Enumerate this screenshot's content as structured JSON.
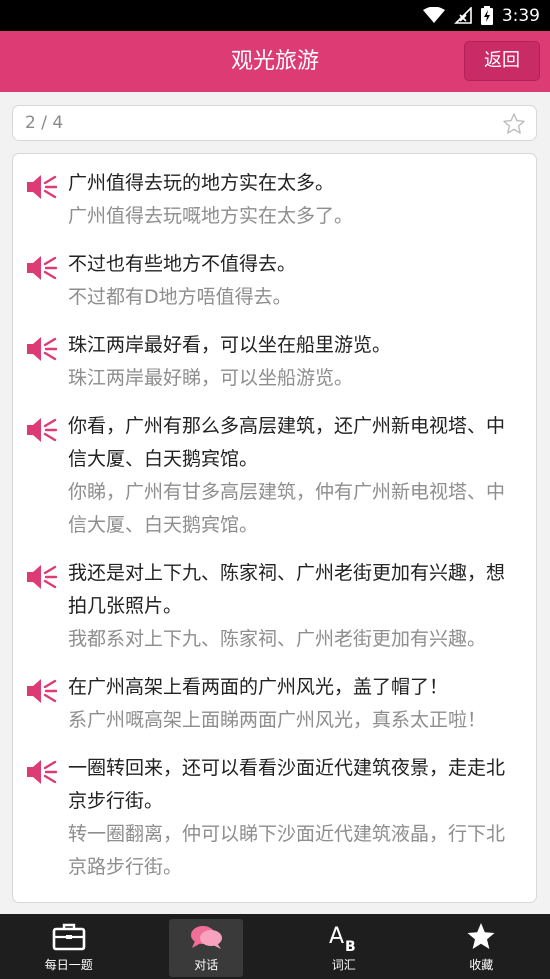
{
  "status_bar": {
    "time": "3:39"
  },
  "header": {
    "title": "观光旅游",
    "back_label": "返回"
  },
  "pager": {
    "text": "2 / 4"
  },
  "entries": [
    {
      "mandarin": "广州值得去玩的地方实在太多。",
      "cantonese": "广州值得去玩嘅地方实在太多了。"
    },
    {
      "mandarin": "不过也有些地方不值得去。",
      "cantonese": "不过都有D地方唔值得去。"
    },
    {
      "mandarin": "珠江两岸最好看，可以坐在船里游览。",
      "cantonese": "珠江两岸最好睇，可以坐船游览。"
    },
    {
      "mandarin": "你看，广州有那么多高层建筑，还广州新电视塔、中信大厦、白天鹅宾馆。",
      "cantonese": "你睇，广州有甘多高层建筑，仲有广州新电视塔、中信大厦、白天鹅宾馆。"
    },
    {
      "mandarin": "我还是对上下九、陈家祠、广州老街更加有兴趣，想拍几张照片。",
      "cantonese": "我都系对上下九、陈家祠、广州老街更加有兴趣。"
    },
    {
      "mandarin": "在广州高架上看两面的广州风光，盖了帽了！",
      "cantonese": "系广州嘅高架上面睇两面广州风光，真系太正啦！"
    },
    {
      "mandarin": "一圈转回来，还可以看看沙面近代建筑夜景，走走北京步行街。",
      "cantonese": "转一圈翻离，仲可以睇下沙面近代建筑液晶，行下北京路步行街。"
    }
  ],
  "tabs": [
    {
      "label": "每日一题",
      "icon": "briefcase-icon",
      "active": false
    },
    {
      "label": "对话",
      "icon": "chat-bubbles-icon",
      "active": true
    },
    {
      "label": "词汇",
      "icon": "ab-letters-icon",
      "active": false
    },
    {
      "label": "收藏",
      "icon": "star-icon",
      "active": false
    }
  ],
  "colors": {
    "accent": "#dd3b74",
    "speaker": "#dd3b74",
    "tabbar": "#1e1e1e"
  }
}
